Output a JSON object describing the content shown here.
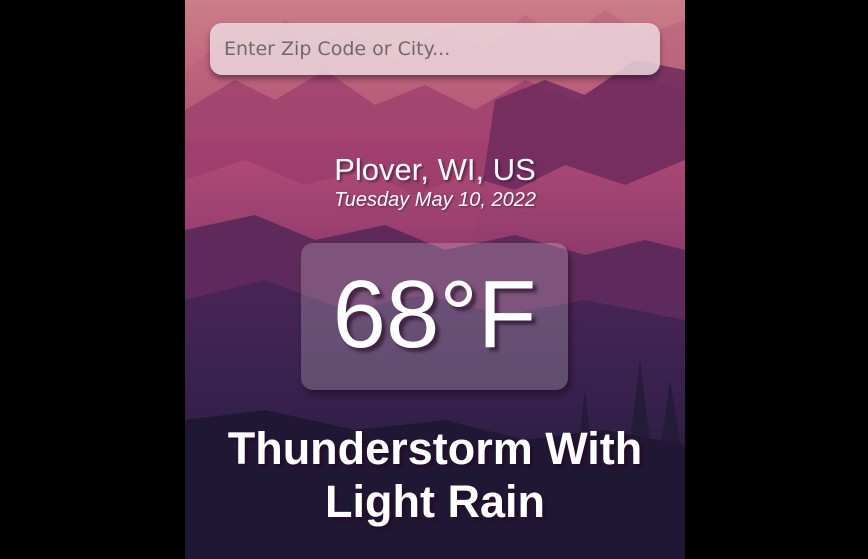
{
  "search": {
    "placeholder": "Enter Zip Code or City...",
    "value": ""
  },
  "weather": {
    "location": "Plover, WI, US",
    "date": "Tuesday May 10, 2022",
    "temperature": "68°F",
    "condition": "Thunderstorm With Light Rain"
  },
  "colors": {
    "outer_background": "#000000",
    "sky_top": "#c97a86",
    "sky_mid": "#a8406e",
    "valley_dark": "#2a1a40",
    "text": "#ffffff"
  }
}
